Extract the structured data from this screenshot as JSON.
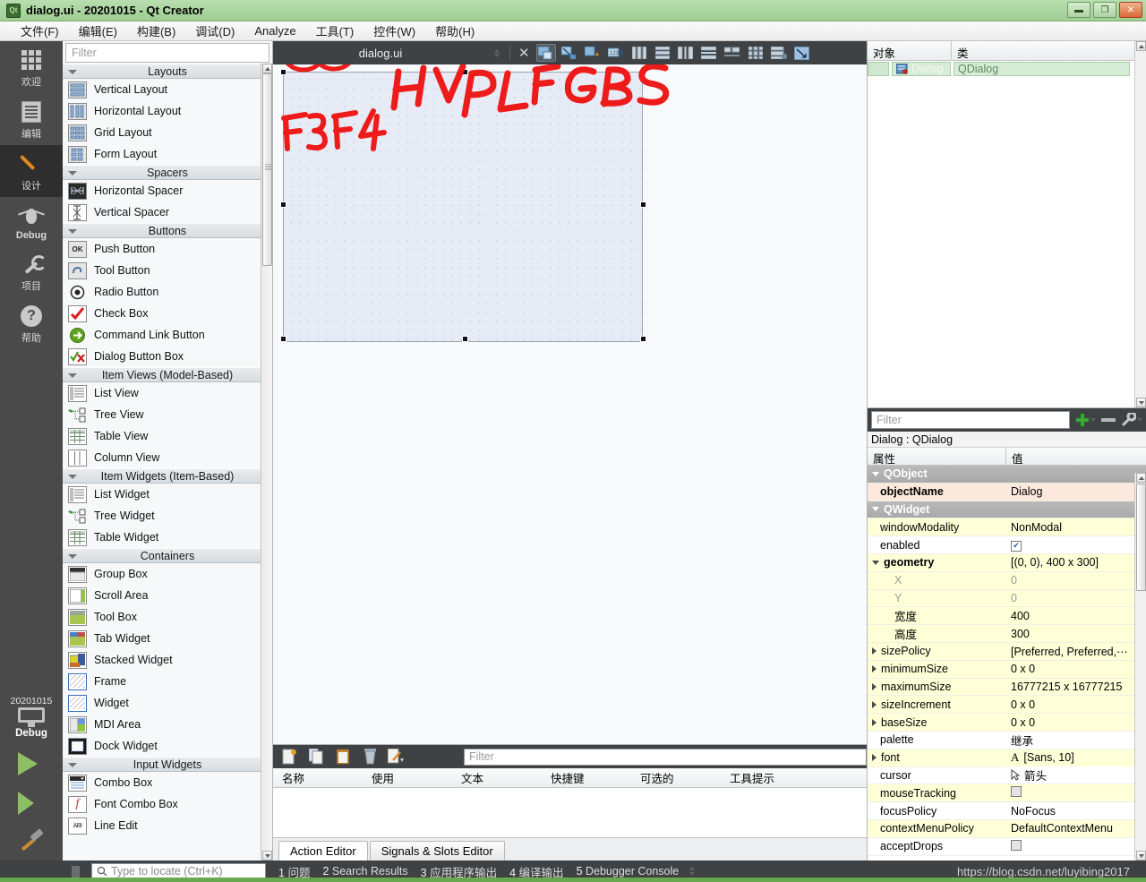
{
  "titlebar": {
    "title": "dialog.ui - 20201015 - Qt Creator",
    "app_icon": "qt-logo-icon",
    "minimize_label": "–",
    "maximize_label": "❐",
    "close_label": "✕"
  },
  "menubar": {
    "items": [
      {
        "label": "文件(F)",
        "mnemonic": "F"
      },
      {
        "label": "编辑(E)",
        "mnemonic": "E"
      },
      {
        "label": "构建(B)",
        "mnemonic": "B"
      },
      {
        "label": "调试(D)",
        "mnemonic": "D"
      },
      {
        "label": "Analyze",
        "mnemonic": "A"
      },
      {
        "label": "工具(T)",
        "mnemonic": "T"
      },
      {
        "label": "控件(W)",
        "mnemonic": "W"
      },
      {
        "label": "帮助(H)",
        "mnemonic": "H"
      }
    ]
  },
  "modebar": {
    "items": [
      {
        "label": "欢迎",
        "icon": "grid-icon",
        "active": false
      },
      {
        "label": "编辑",
        "icon": "document-icon",
        "active": false
      },
      {
        "label": "设计",
        "icon": "pencil-icon",
        "active": true
      },
      {
        "label": "Debug",
        "icon": "bug-icon",
        "active": false
      },
      {
        "label": "项目",
        "icon": "wrench-icon",
        "active": false
      },
      {
        "label": "帮助",
        "icon": "question-icon",
        "active": false
      }
    ],
    "kit": {
      "name": "20201015",
      "build_config": "Debug",
      "icon": "monitor-icon"
    },
    "run_label": "run-button",
    "debug_label": "debug-button",
    "build_label": "build-button"
  },
  "widgetbox": {
    "filter_placeholder": "Filter",
    "categories": [
      {
        "name": "Layouts",
        "items": [
          {
            "label": "Vertical Layout",
            "icon": "vertical-layout-icon"
          },
          {
            "label": "Horizontal Layout",
            "icon": "horizontal-layout-icon"
          },
          {
            "label": "Grid Layout",
            "icon": "grid-layout-icon"
          },
          {
            "label": "Form Layout",
            "icon": "form-layout-icon"
          }
        ]
      },
      {
        "name": "Spacers",
        "items": [
          {
            "label": "Horizontal Spacer",
            "icon": "horizontal-spacer-icon"
          },
          {
            "label": "Vertical Spacer",
            "icon": "vertical-spacer-icon"
          }
        ]
      },
      {
        "name": "Buttons",
        "items": [
          {
            "label": "Push Button",
            "icon": "push-button-icon"
          },
          {
            "label": "Tool Button",
            "icon": "tool-button-icon"
          },
          {
            "label": "Radio Button",
            "icon": "radio-button-icon"
          },
          {
            "label": "Check Box",
            "icon": "check-box-icon"
          },
          {
            "label": "Command Link Button",
            "icon": "command-link-icon"
          },
          {
            "label": "Dialog Button Box",
            "icon": "dialog-button-box-icon"
          }
        ]
      },
      {
        "name": "Item Views (Model-Based)",
        "items": [
          {
            "label": "List View",
            "icon": "list-view-icon"
          },
          {
            "label": "Tree View",
            "icon": "tree-view-icon"
          },
          {
            "label": "Table View",
            "icon": "table-view-icon"
          },
          {
            "label": "Column View",
            "icon": "column-view-icon"
          }
        ]
      },
      {
        "name": "Item Widgets (Item-Based)",
        "items": [
          {
            "label": "List Widget",
            "icon": "list-widget-icon"
          },
          {
            "label": "Tree Widget",
            "icon": "tree-widget-icon"
          },
          {
            "label": "Table Widget",
            "icon": "table-widget-icon"
          }
        ]
      },
      {
        "name": "Containers",
        "items": [
          {
            "label": "Group Box",
            "icon": "group-box-icon"
          },
          {
            "label": "Scroll Area",
            "icon": "scroll-area-icon"
          },
          {
            "label": "Tool Box",
            "icon": "tool-box-icon"
          },
          {
            "label": "Tab Widget",
            "icon": "tab-widget-icon"
          },
          {
            "label": "Stacked Widget",
            "icon": "stacked-widget-icon"
          },
          {
            "label": "Frame",
            "icon": "frame-icon"
          },
          {
            "label": "Widget",
            "icon": "widget-icon"
          },
          {
            "label": "MDI Area",
            "icon": "mdi-area-icon"
          },
          {
            "label": "Dock Widget",
            "icon": "dock-widget-icon"
          }
        ]
      },
      {
        "name": "Input Widgets",
        "items": [
          {
            "label": "Combo Box",
            "icon": "combo-box-icon"
          },
          {
            "label": "Font Combo Box",
            "icon": "font-combo-box-icon"
          },
          {
            "label": "Line Edit",
            "icon": "line-edit-icon"
          }
        ]
      }
    ]
  },
  "editor": {
    "filename": "dialog.ui",
    "close_label": "✕",
    "toolbar_icons": [
      "break-layout-icon",
      "adjust-size-icon",
      "edit-tab-order-icon",
      "edit-buddies-icon",
      "layout-horizontally-icon",
      "layout-vertically-icon",
      "layout-horizontally-splitter-icon",
      "layout-vertically-splitter-icon",
      "layout-form-icon",
      "layout-grid-icon",
      "layout-in-grid-icon",
      "preview-icon"
    ]
  },
  "annotations": {
    "shortcut_f3": "F3",
    "shortcut_f4": "F4",
    "letters": "HVPLFGBS",
    "color": "#ee1b1b",
    "circled_icons": 2
  },
  "action_editor": {
    "filter_placeholder": "Filter",
    "toolbar_icons": [
      "new-action-icon",
      "copy-icon",
      "paste-icon",
      "delete-icon",
      "edit-action-icon"
    ],
    "columns": [
      "名称",
      "使用",
      "文本",
      "快捷键",
      "可选的",
      "工具提示"
    ],
    "rows": [],
    "tabs": [
      {
        "label": "Action Editor",
        "active": true
      },
      {
        "label": "Signals & Slots Editor",
        "active": false
      }
    ]
  },
  "object_inspector": {
    "columns": [
      "对象",
      "类"
    ],
    "rows": [
      {
        "object": "Dialog",
        "class": "QDialog",
        "icon": "dialog-icon",
        "selected": true
      }
    ]
  },
  "property_editor": {
    "filter_placeholder": "Filter",
    "toolbar": {
      "add_label": "+",
      "remove_label": "–",
      "configure_label": "wrench-icon"
    },
    "object_line": "Dialog : QDialog",
    "columns": [
      "属性",
      "值"
    ],
    "rows": [
      {
        "name": "QObject",
        "value": "",
        "kind": "group",
        "expander": "down"
      },
      {
        "name": "objectName",
        "value": "Dialog",
        "kind": "highlight",
        "bold": true
      },
      {
        "name": "QWidget",
        "value": "",
        "kind": "group",
        "expander": "down"
      },
      {
        "name": "windowModality",
        "value": "NonModal",
        "kind": "yellow"
      },
      {
        "name": "enabled",
        "value": "",
        "kind": "white",
        "control": "checkbox-checked"
      },
      {
        "name": "geometry",
        "value": "[(0, 0), 400 x 300]",
        "kind": "yellow",
        "bold": true,
        "expander": "down"
      },
      {
        "name": "X",
        "value": "0",
        "kind": "yellow",
        "indent": 2,
        "disabled": true
      },
      {
        "name": "Y",
        "value": "0",
        "kind": "yellow",
        "indent": 2,
        "disabled": true
      },
      {
        "name": "宽度",
        "value": "400",
        "kind": "yellow",
        "indent": 2
      },
      {
        "name": "高度",
        "value": "300",
        "kind": "yellow",
        "indent": 2
      },
      {
        "name": "sizePolicy",
        "value": "[Preferred, Preferred,⋯",
        "kind": "yellow",
        "expander": "right"
      },
      {
        "name": "minimumSize",
        "value": "0 x 0",
        "kind": "yellow",
        "expander": "right"
      },
      {
        "name": "maximumSize",
        "value": "16777215 x 16777215",
        "kind": "yellow",
        "expander": "right"
      },
      {
        "name": "sizeIncrement",
        "value": "0 x 0",
        "kind": "yellow",
        "expander": "right"
      },
      {
        "name": "baseSize",
        "value": "0 x 0",
        "kind": "yellow",
        "expander": "right"
      },
      {
        "name": "palette",
        "value": "继承",
        "kind": "white"
      },
      {
        "name": "font",
        "value": "[Sans, 10]",
        "kind": "yellow",
        "expander": "right",
        "control": "font-A"
      },
      {
        "name": "cursor",
        "value": "箭头",
        "kind": "white",
        "control": "cursor-arrow"
      },
      {
        "name": "mouseTracking",
        "value": "",
        "kind": "yellow",
        "control": "checkbox-unchecked"
      },
      {
        "name": "focusPolicy",
        "value": "NoFocus",
        "kind": "white"
      },
      {
        "name": "contextMenuPolicy",
        "value": "DefaultContextMenu",
        "kind": "yellow"
      },
      {
        "name": "acceptDrops",
        "value": "",
        "kind": "white",
        "control": "checkbox-unchecked"
      }
    ]
  },
  "statusbar": {
    "locator_placeholder": "Type to locate (Ctrl+K)",
    "panes": [
      {
        "num": "1",
        "label": "问题"
      },
      {
        "num": "2",
        "label": "Search Results"
      },
      {
        "num": "3",
        "label": "应用程序输出"
      },
      {
        "num": "4",
        "label": "编译输出"
      },
      {
        "num": "5",
        "label": "Debugger Console"
      }
    ],
    "watermark": "https://blog.csdn.net/luyibing2017"
  }
}
